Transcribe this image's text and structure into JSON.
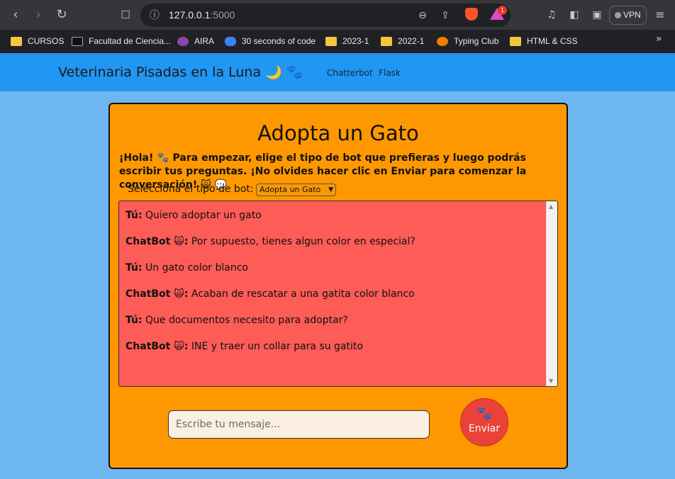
{
  "browser": {
    "url_host": "127.0.0.1",
    "url_port": ":5000",
    "vpn_label": "VPN",
    "rewards_badge": "1",
    "bookmarks": [
      {
        "label": "CURSOS",
        "icon": "folder-icon"
      },
      {
        "label": "Facultad de Ciencia...",
        "icon": "faculty-logo-icon"
      },
      {
        "label": "AIRA",
        "icon": "aira-logo-icon"
      },
      {
        "label": "30 seconds of code",
        "icon": "code-logo-icon"
      },
      {
        "label": "2023-1",
        "icon": "folder-icon"
      },
      {
        "label": "2022-1",
        "icon": "folder-icon"
      },
      {
        "label": "Typing Club",
        "icon": "typing-club-icon"
      },
      {
        "label": "HTML & CSS",
        "icon": "folder-icon"
      }
    ]
  },
  "site": {
    "brand": "Veterinaria Pisadas en la Luna 🌙 🐾",
    "nav_links": [
      "Chatterbot",
      "Flask"
    ]
  },
  "card": {
    "title": "Adopta un Gato",
    "intro": "¡Hola! 🐾 Para empezar, elige el tipo de bot que prefieras y luego podrás escribir tus preguntas. ¡No olvides hacer clic en Enviar para comenzar la conversación! 🙀 💬",
    "select_label": "Selecciona el tipo de bot:",
    "select_value": "Adopta un Gato",
    "messages": [
      {
        "who": "Tú:",
        "text": " Quiero adoptar un gato"
      },
      {
        "who": "ChatBot 🙀:",
        "text": " Por supuesto, tienes algun color en especial?"
      },
      {
        "who": "Tú:",
        "text": " Un gato color blanco"
      },
      {
        "who": "ChatBot 🙀:",
        "text": " Acaban de rescatar a una gatita color blanco"
      },
      {
        "who": "Tú:",
        "text": " Que documentos necesito para adoptar?"
      },
      {
        "who": "ChatBot 🙀:",
        "text": " INE y traer un collar para su gatito"
      }
    ],
    "input_placeholder": "Escribe tu mensaje...",
    "send_label": "Enviar",
    "send_icon": "🐾"
  },
  "colors": {
    "navbar": "#2196f3",
    "page_bg": "#6db6f0",
    "card_bg": "#ff9800",
    "chat_bg": "#fe5c57",
    "send_bg": "#ea4138"
  }
}
